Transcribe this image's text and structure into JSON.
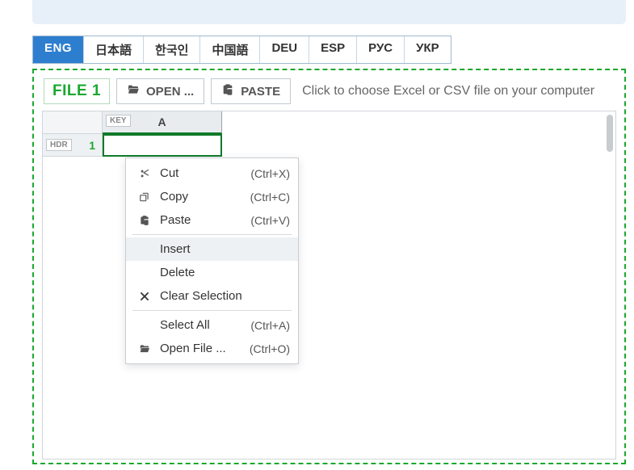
{
  "lang_tabs": {
    "items": [
      {
        "label": "ENG",
        "active": true
      },
      {
        "label": "日本語"
      },
      {
        "label": "한국인"
      },
      {
        "label": "中国語"
      },
      {
        "label": "DEU"
      },
      {
        "label": "ESP"
      },
      {
        "label": "РУС"
      },
      {
        "label": "УКР"
      }
    ]
  },
  "file_panel": {
    "file_label": "FILE 1",
    "open_label": "OPEN ...",
    "paste_label": "PASTE",
    "hint": "Click to choose Excel or CSV file on your computer"
  },
  "sheet": {
    "key_tag": "KEY",
    "col_a": "A",
    "hdr_tag": "HDR",
    "row_1": "1"
  },
  "context_menu": {
    "items": [
      {
        "icon": "scissors",
        "label": "Cut",
        "shortcut": "(Ctrl+X)"
      },
      {
        "icon": "copy",
        "label": "Copy",
        "shortcut": "(Ctrl+C)"
      },
      {
        "icon": "paste",
        "label": "Paste",
        "shortcut": "(Ctrl+V)"
      },
      {
        "sep": true
      },
      {
        "icon": "",
        "label": "Insert",
        "shortcut": "",
        "highlight": true
      },
      {
        "icon": "",
        "label": "Delete",
        "shortcut": ""
      },
      {
        "icon": "x",
        "label": "Clear Selection",
        "shortcut": ""
      },
      {
        "sep": true
      },
      {
        "icon": "",
        "label": "Select All",
        "shortcut": "(Ctrl+A)"
      },
      {
        "icon": "folder-open",
        "label": "Open File ...",
        "shortcut": "(Ctrl+O)"
      }
    ]
  }
}
